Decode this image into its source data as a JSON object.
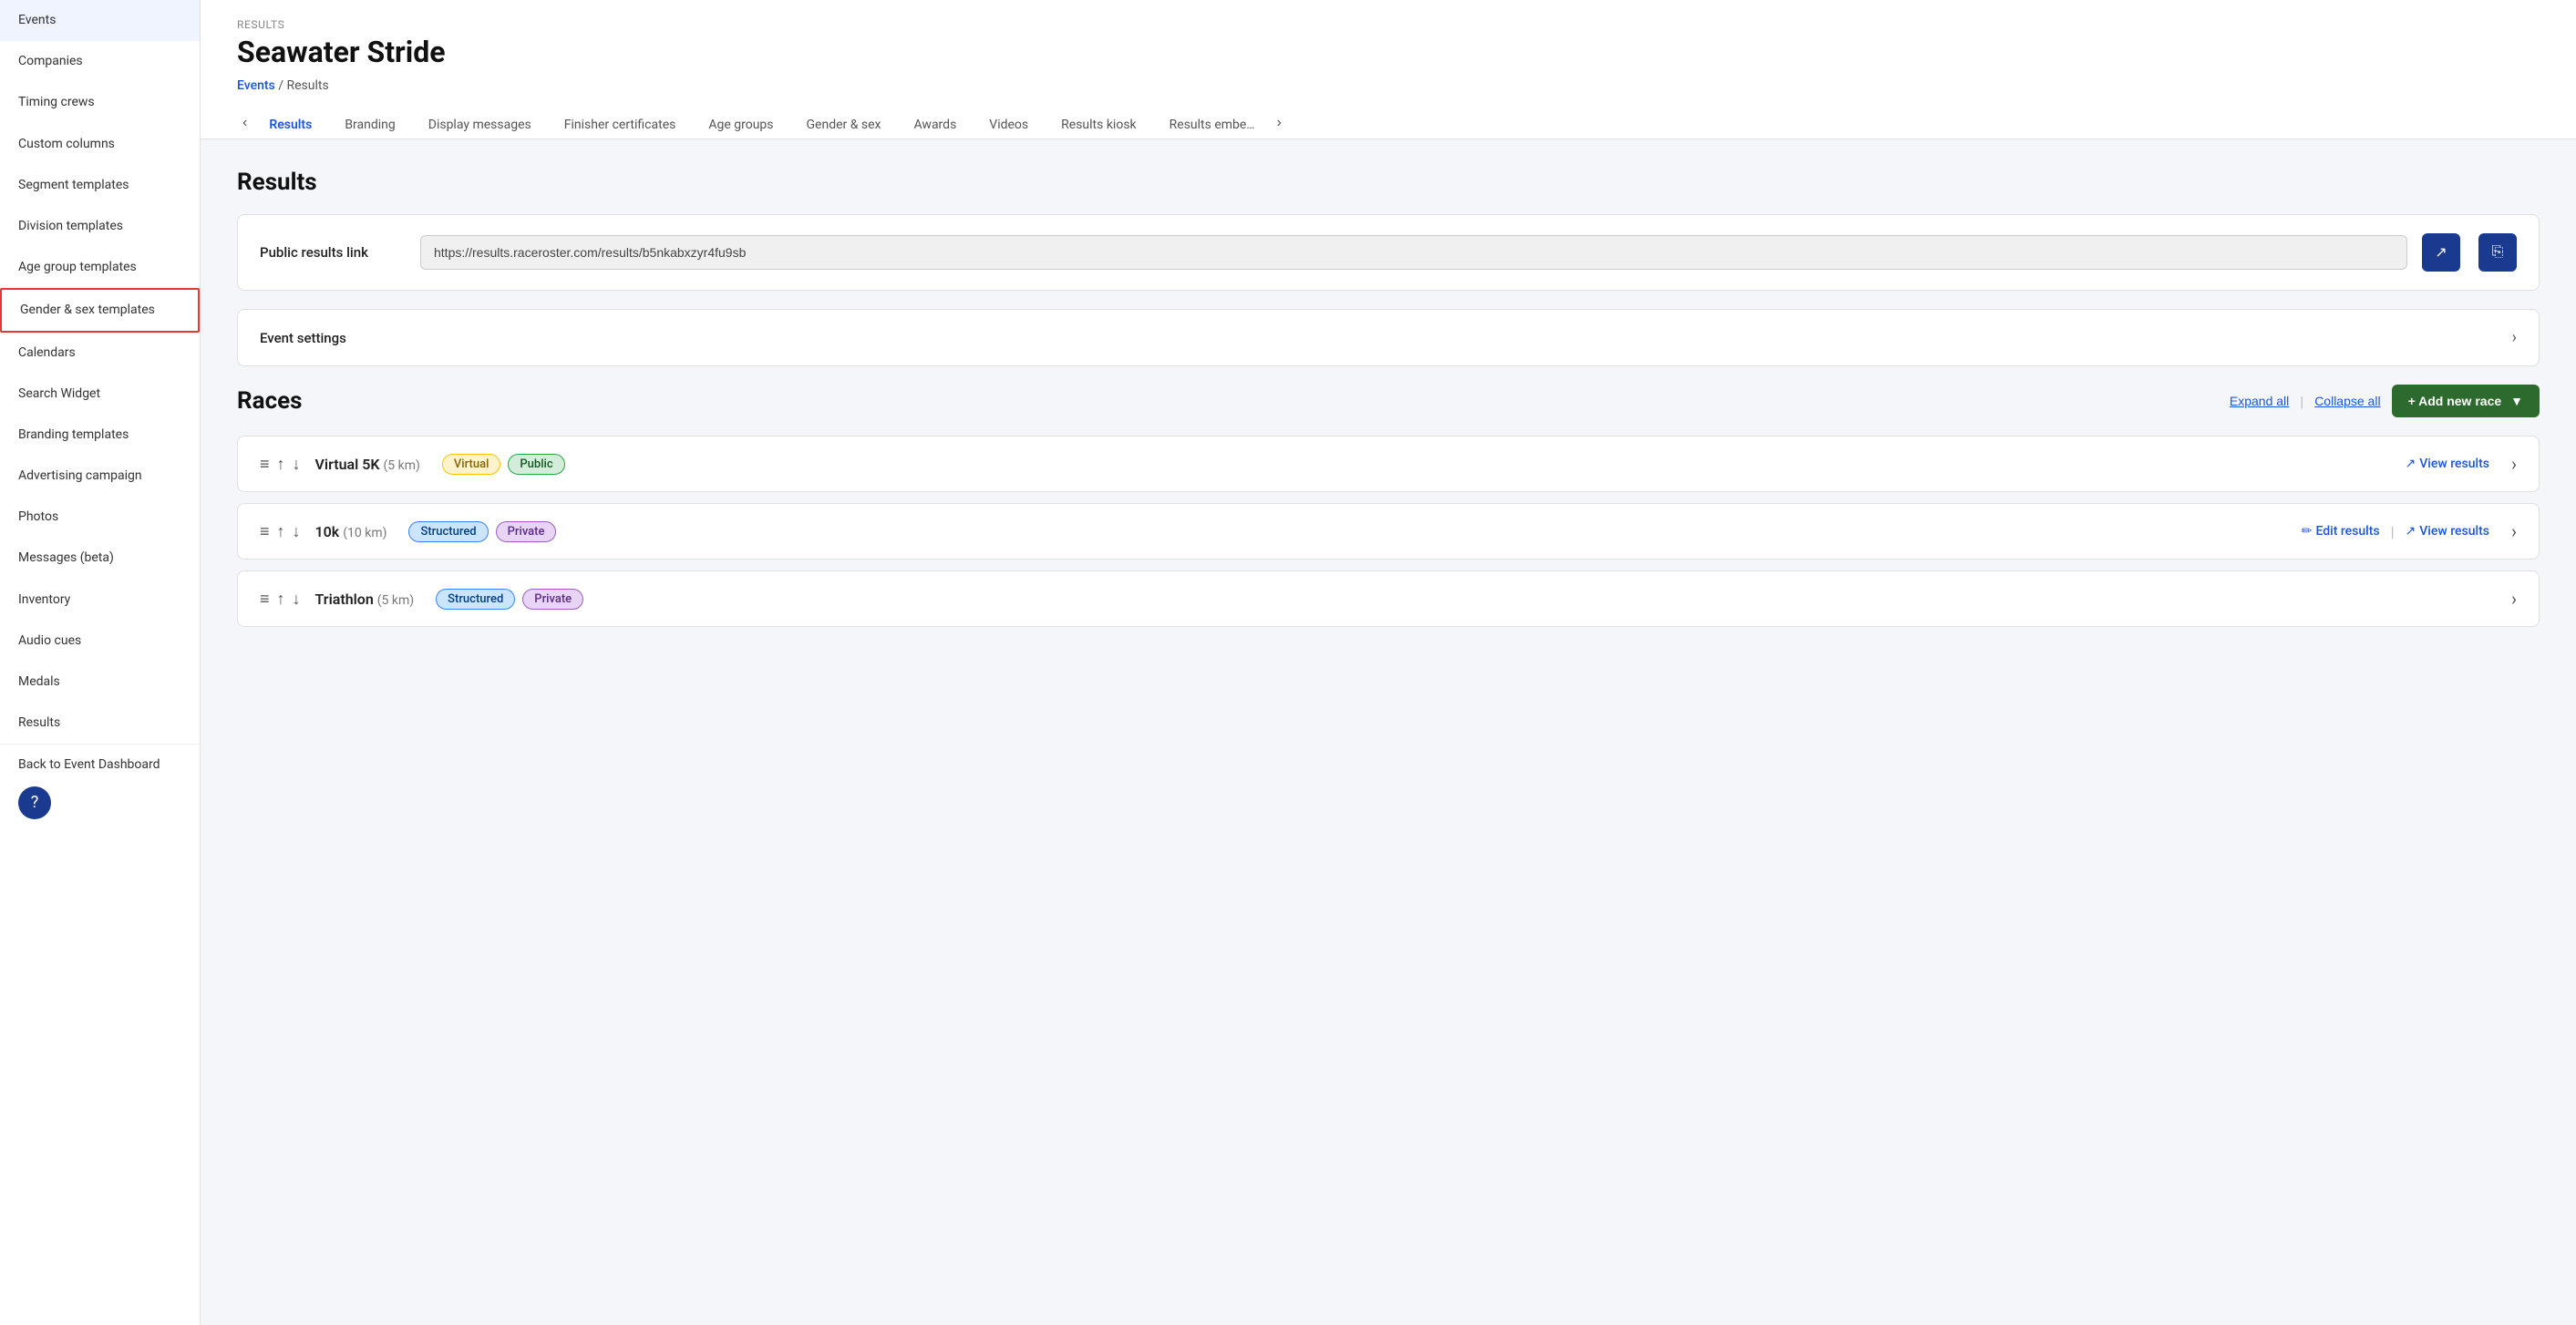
{
  "sidebar": {
    "items": [
      {
        "id": "events",
        "label": "Events",
        "active": false
      },
      {
        "id": "companies",
        "label": "Companies",
        "active": false
      },
      {
        "id": "timing-crews",
        "label": "Timing crews",
        "active": false
      },
      {
        "id": "custom-columns",
        "label": "Custom columns",
        "active": false
      },
      {
        "id": "segment-templates",
        "label": "Segment templates",
        "active": false
      },
      {
        "id": "division-templates",
        "label": "Division templates",
        "active": false
      },
      {
        "id": "age-group-templates",
        "label": "Age group templates",
        "active": false
      },
      {
        "id": "gender-sex-templates",
        "label": "Gender & sex templates",
        "active": true
      },
      {
        "id": "calendars",
        "label": "Calendars",
        "active": false
      },
      {
        "id": "search-widget",
        "label": "Search Widget",
        "active": false
      },
      {
        "id": "branding-templates",
        "label": "Branding templates",
        "active": false
      },
      {
        "id": "advertising-campaign",
        "label": "Advertising campaign",
        "active": false
      },
      {
        "id": "photos",
        "label": "Photos",
        "active": false
      },
      {
        "id": "messages-beta",
        "label": "Messages (beta)",
        "active": false
      },
      {
        "id": "inventory",
        "label": "Inventory",
        "active": false
      },
      {
        "id": "audio-cues",
        "label": "Audio cues",
        "active": false
      },
      {
        "id": "medals",
        "label": "Medals",
        "active": false
      },
      {
        "id": "results",
        "label": "Results",
        "active": false
      },
      {
        "id": "back",
        "label": "Back to Event Dashboard",
        "active": false
      }
    ]
  },
  "header": {
    "results_label": "RESULTS",
    "title": "Seawater Stride",
    "breadcrumb_events": "Events",
    "breadcrumb_separator": "/",
    "breadcrumb_current": "Results"
  },
  "tabs": [
    {
      "id": "results",
      "label": "Results",
      "active": true
    },
    {
      "id": "branding",
      "label": "Branding",
      "active": false
    },
    {
      "id": "display-messages",
      "label": "Display messages",
      "active": false
    },
    {
      "id": "finisher-certificates",
      "label": "Finisher certificates",
      "active": false
    },
    {
      "id": "age-groups",
      "label": "Age groups",
      "active": false
    },
    {
      "id": "gender-sex",
      "label": "Gender & sex",
      "active": false
    },
    {
      "id": "awards",
      "label": "Awards",
      "active": false
    },
    {
      "id": "videos",
      "label": "Videos",
      "active": false
    },
    {
      "id": "results-kiosk",
      "label": "Results kiosk",
      "active": false
    },
    {
      "id": "results-embed",
      "label": "Results embe…",
      "active": false
    }
  ],
  "content": {
    "results_section_title": "Results",
    "public_results_link_label": "Public results link",
    "public_results_link_url": "https://results.raceroster.com/results/b5nkabxzyr4fu9sb",
    "event_settings_label": "Event settings",
    "races_section_title": "Races",
    "expand_all": "Expand all",
    "collapse_all": "Collapse all",
    "add_race_btn": "+ Add new race",
    "races": [
      {
        "name": "Virtual 5K",
        "distance": "(5 km)",
        "badges": [
          {
            "label": "Virtual",
            "type": "virtual"
          },
          {
            "label": "Public",
            "type": "public"
          }
        ],
        "actions": [
          {
            "id": "view-results",
            "label": "View results",
            "icon": "↗"
          }
        ]
      },
      {
        "name": "10k",
        "distance": "(10 km)",
        "badges": [
          {
            "label": "Structured",
            "type": "structured"
          },
          {
            "label": "Private",
            "type": "private"
          }
        ],
        "actions": [
          {
            "id": "edit-results",
            "label": "Edit results",
            "icon": "✏"
          },
          {
            "id": "view-results",
            "label": "View results",
            "icon": "↗"
          }
        ]
      },
      {
        "name": "Triathlon",
        "distance": "(5 km)",
        "badges": [
          {
            "label": "Structured",
            "type": "structured"
          },
          {
            "label": "Private",
            "type": "private"
          }
        ],
        "actions": []
      }
    ]
  }
}
